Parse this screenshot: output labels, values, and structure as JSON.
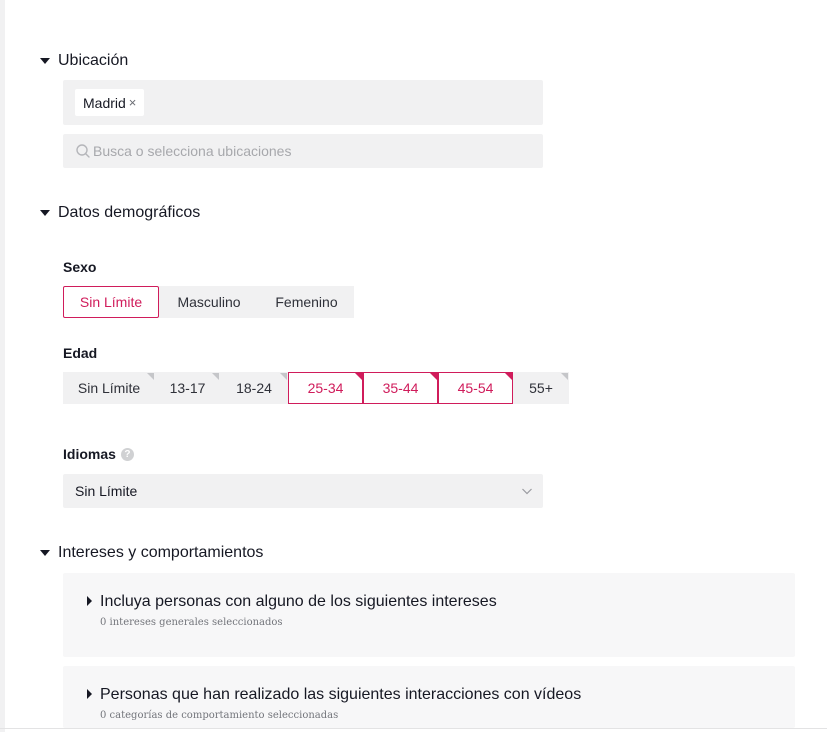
{
  "sections": {
    "location": {
      "title": "Ubicación",
      "selected_tag": "Madrid",
      "tag_close": "×",
      "search_placeholder": "Busca o selecciona ubicaciones"
    },
    "demographics": {
      "title": "Datos demográficos",
      "sex": {
        "label": "Sexo",
        "options": [
          "Sin Límite",
          "Masculino",
          "Femenino"
        ],
        "selected": "Sin Límite"
      },
      "age": {
        "label": "Edad",
        "options": [
          "Sin Límite",
          "13-17",
          "18-24",
          "25-34",
          "35-44",
          "45-54",
          "55+"
        ],
        "selected": [
          "25-34",
          "35-44",
          "45-54"
        ]
      },
      "languages": {
        "label": "Idiomas",
        "help_icon": "question-circle-icon",
        "help_glyph": "?",
        "value": "Sin Límite"
      }
    },
    "interests": {
      "title": "Intereses y comportamientos",
      "cards": [
        {
          "title": "Incluya personas con alguno de los siguientes intereses",
          "subtitle": "0 intereses generales seleccionados"
        },
        {
          "title": "Personas que han realizado las siguientes interacciones con vídeos",
          "subtitle": "0 categorías de comportamiento seleccionadas"
        }
      ]
    }
  },
  "colors": {
    "accent": "#d01c5b",
    "field_bg": "#f1f1f2",
    "card_bg": "#f7f7f8",
    "text": "#161823",
    "muted": "#73757b"
  }
}
